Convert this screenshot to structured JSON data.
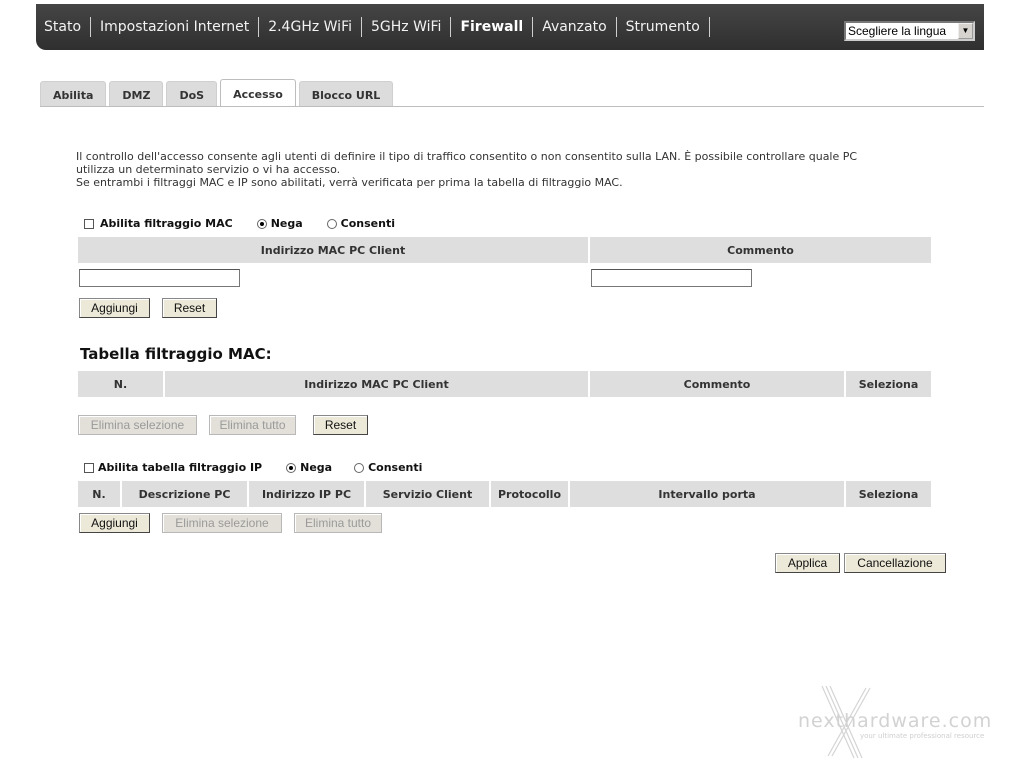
{
  "nav": {
    "items": [
      "Stato",
      "Impostazioni Internet",
      "2.4GHz WiFi",
      "5GHz WiFi",
      "Firewall",
      "Avanzato",
      "Strumento"
    ],
    "active": "Firewall",
    "language_select": "Scegliere la lingua"
  },
  "tabs": [
    "Abilita",
    "DMZ",
    "DoS",
    "Accesso",
    "Blocco URL"
  ],
  "active_tab": "Accesso",
  "intro": {
    "line1": "Il controllo dell'accesso consente agli utenti di definire il tipo di traffico consentito o non consentito sulla LAN. È possibile controllare quale PC",
    "line2": "utilizza un determinato servizio o vi ha accesso.",
    "line3": "Se entrambi i filtraggi MAC e IP sono abilitati, verrà verificata per prima la tabella di filtraggio MAC."
  },
  "mac_filter": {
    "enable_label": "Abilita filtraggio MAC",
    "deny_label": "Nega",
    "allow_label": "Consenti",
    "selected": "Nega",
    "enabled": false,
    "col_mac": "Indirizzo MAC PC Client",
    "col_comment": "Commento",
    "mac_value": "",
    "comment_value": "",
    "add_button": "Aggiungi",
    "reset_button": "Reset"
  },
  "mac_table": {
    "title": "Tabella filtraggio MAC:",
    "columns": [
      "N.",
      "Indirizzo MAC PC Client",
      "Commento",
      "Seleziona"
    ],
    "delete_selected": "Elimina selezione",
    "delete_all": "Elimina tutto",
    "reset": "Reset"
  },
  "ip_filter": {
    "enable_label": "Abilita tabella filtraggio IP",
    "deny_label": "Nega",
    "allow_label": "Consenti",
    "selected": "Nega",
    "enabled": false,
    "columns": [
      "N.",
      "Descrizione PC",
      "Indirizzo IP PC",
      "Servizio Client",
      "Protocollo",
      "Intervallo porta",
      "Seleziona"
    ],
    "add_button": "Aggiungi",
    "delete_selected": "Elimina selezione",
    "delete_all": "Elimina tutto"
  },
  "footer": {
    "apply": "Applica",
    "cancel": "Cancellazione"
  },
  "watermark": {
    "text": "nexthardware.com",
    "tagline": "your ultimate professional resource"
  }
}
